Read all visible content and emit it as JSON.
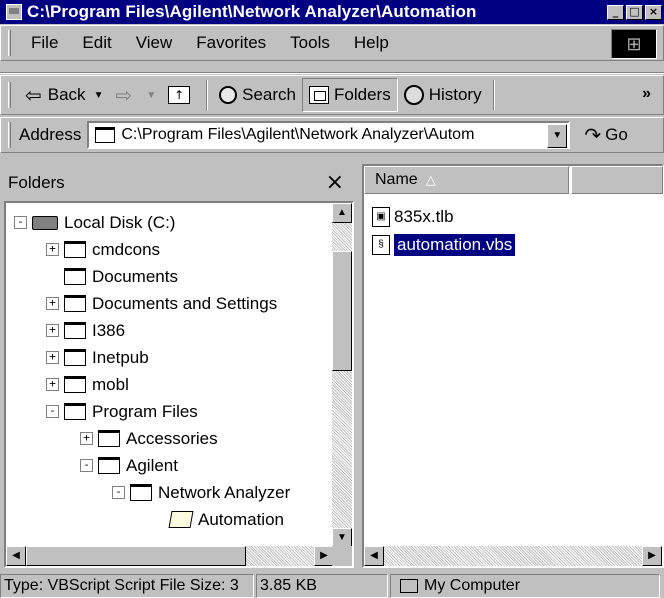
{
  "window": {
    "title": "C:\\Program Files\\Agilent\\Network Analyzer\\Automation"
  },
  "menu": {
    "items": [
      {
        "label": "File"
      },
      {
        "label": "Edit"
      },
      {
        "label": "View"
      },
      {
        "label": "Favorites"
      },
      {
        "label": "Tools"
      },
      {
        "label": "Help"
      }
    ]
  },
  "toolbar": {
    "back_label": "Back",
    "search_label": "Search",
    "folders_label": "Folders",
    "history_label": "History",
    "overflow_label": "»"
  },
  "address": {
    "label": "Address",
    "value": "C:\\Program Files\\Agilent\\Network Analyzer\\Autom",
    "go_label": "Go"
  },
  "folders_pane": {
    "title": "Folders",
    "close_label": "×",
    "tree": [
      {
        "label": "Local Disk (C:)",
        "expander": "-"
      },
      {
        "label": "cmdcons",
        "expander": "+"
      },
      {
        "label": "Documents",
        "expander": ""
      },
      {
        "label": "Documents and Settings",
        "expander": "+"
      },
      {
        "label": "I386",
        "expander": "+"
      },
      {
        "label": "Inetpub",
        "expander": "+"
      },
      {
        "label": "mobl",
        "expander": "+"
      },
      {
        "label": "Program Files",
        "expander": "-"
      },
      {
        "label": "Accessories",
        "expander": "+"
      },
      {
        "label": "Agilent",
        "expander": "-"
      },
      {
        "label": "Network Analyzer",
        "expander": "-"
      },
      {
        "label": "Automation",
        "expander": ""
      }
    ]
  },
  "files_pane": {
    "column_name": "Name",
    "sort_indicator": "△",
    "files": [
      {
        "name": "835x.tlb",
        "selected": false,
        "icon": "typelib-file-icon"
      },
      {
        "name": "automation.vbs",
        "selected": true,
        "icon": "vbscript-file-icon"
      }
    ]
  },
  "statusbar": {
    "type_text": "Type: VBScript Script File Size: 3",
    "size_text": "3.85 KB",
    "zone_text": "My Computer"
  }
}
